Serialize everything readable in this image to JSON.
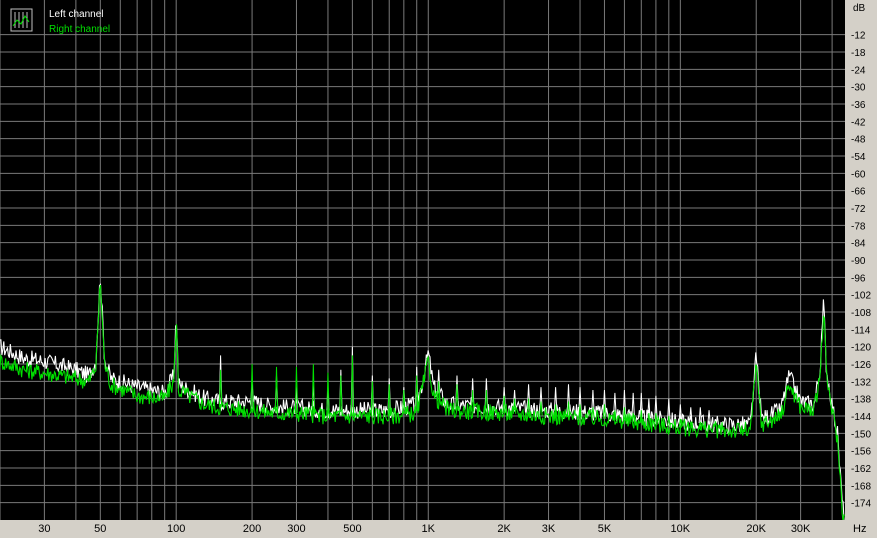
{
  "chart_data": {
    "type": "line",
    "x_scale": "log",
    "xlim": [
      20,
      45000
    ],
    "ylim": [
      -180,
      0
    ],
    "grid": true,
    "legend_position": "top-left",
    "xlabel_unit": "Hz",
    "ylabel_unit": "dB",
    "x_ticks": [
      {
        "value": 30,
        "label": "30"
      },
      {
        "value": 50,
        "label": "50"
      },
      {
        "value": 100,
        "label": "100"
      },
      {
        "value": 200,
        "label": "200"
      },
      {
        "value": 300,
        "label": "300"
      },
      {
        "value": 500,
        "label": "500"
      },
      {
        "value": 1000,
        "label": "1K"
      },
      {
        "value": 2000,
        "label": "2K"
      },
      {
        "value": 3000,
        "label": "3K"
      },
      {
        "value": 5000,
        "label": "5K"
      },
      {
        "value": 10000,
        "label": "10K"
      },
      {
        "value": 20000,
        "label": "20K"
      },
      {
        "value": 30000,
        "label": "30K"
      }
    ],
    "y_ticks": [
      -12,
      -18,
      -24,
      -30,
      -36,
      -42,
      -48,
      -54,
      -60,
      -66,
      -72,
      -78,
      -84,
      -90,
      -96,
      -102,
      -108,
      -114,
      -120,
      -126,
      -132,
      -138,
      -144,
      -150,
      -156,
      -162,
      -168,
      -174
    ],
    "series": [
      {
        "name": "Left channel",
        "color": "#ffffff",
        "points": [
          [
            20,
            -120
          ],
          [
            25,
            -124
          ],
          [
            30,
            -125
          ],
          [
            40,
            -128
          ],
          [
            45,
            -130
          ],
          [
            48,
            -125
          ],
          [
            50,
            -95
          ],
          [
            52,
            -124
          ],
          [
            55,
            -131
          ],
          [
            70,
            -134
          ],
          [
            90,
            -136
          ],
          [
            98,
            -130
          ],
          [
            100,
            -107
          ],
          [
            102,
            -133
          ],
          [
            130,
            -138
          ],
          [
            150,
            -139
          ],
          [
            200,
            -139
          ],
          [
            250,
            -141
          ],
          [
            300,
            -141
          ],
          [
            400,
            -142
          ],
          [
            500,
            -142
          ],
          [
            700,
            -142
          ],
          [
            900,
            -140
          ],
          [
            950,
            -132
          ],
          [
            1000,
            -122
          ],
          [
            1050,
            -134
          ],
          [
            1200,
            -140
          ],
          [
            2000,
            -141
          ],
          [
            3000,
            -142
          ],
          [
            5000,
            -143
          ],
          [
            8000,
            -145
          ],
          [
            10000,
            -146
          ],
          [
            15000,
            -147
          ],
          [
            19000,
            -147
          ],
          [
            20000,
            -123
          ],
          [
            21000,
            -145
          ],
          [
            25000,
            -142
          ],
          [
            27000,
            -130
          ],
          [
            30000,
            -139
          ],
          [
            34000,
            -140
          ],
          [
            36000,
            -126
          ],
          [
            37000,
            -104
          ],
          [
            38000,
            -128
          ],
          [
            40000,
            -140
          ],
          [
            42000,
            -150
          ],
          [
            44000,
            -175
          ],
          [
            45000,
            -180
          ]
        ],
        "peaks": [
          [
            150,
            -123
          ],
          [
            200,
            -132
          ],
          [
            250,
            -130
          ],
          [
            300,
            -134
          ],
          [
            350,
            -133
          ],
          [
            400,
            -134
          ],
          [
            450,
            -128
          ],
          [
            500,
            -120
          ],
          [
            600,
            -130
          ],
          [
            700,
            -131
          ],
          [
            800,
            -134
          ],
          [
            900,
            -127
          ],
          [
            1100,
            -128
          ],
          [
            1300,
            -130
          ],
          [
            1500,
            -131
          ],
          [
            1700,
            -131
          ],
          [
            2000,
            -134
          ],
          [
            2200,
            -135
          ],
          [
            2500,
            -133
          ],
          [
            2800,
            -134
          ],
          [
            3200,
            -134
          ],
          [
            3600,
            -133
          ],
          [
            4000,
            -134
          ],
          [
            4500,
            -135
          ],
          [
            5000,
            -135
          ],
          [
            5500,
            -136
          ],
          [
            6000,
            -135
          ],
          [
            6500,
            -136
          ],
          [
            7000,
            -136
          ],
          [
            7500,
            -138
          ],
          [
            8000,
            -137
          ],
          [
            9000,
            -138
          ],
          [
            10000,
            -140
          ],
          [
            11000,
            -141
          ],
          [
            12000,
            -141
          ],
          [
            13000,
            -142
          ]
        ]
      },
      {
        "name": "Right channel",
        "color": "#00e000",
        "points": [
          [
            20,
            -125
          ],
          [
            25,
            -128
          ],
          [
            30,
            -129
          ],
          [
            40,
            -131
          ],
          [
            45,
            -132
          ],
          [
            48,
            -127
          ],
          [
            50,
            -97
          ],
          [
            52,
            -126
          ],
          [
            55,
            -133
          ],
          [
            70,
            -137
          ],
          [
            90,
            -138
          ],
          [
            98,
            -132
          ],
          [
            100,
            -109
          ],
          [
            102,
            -135
          ],
          [
            130,
            -140
          ],
          [
            150,
            -141
          ],
          [
            200,
            -142
          ],
          [
            250,
            -143
          ],
          [
            300,
            -143
          ],
          [
            400,
            -144
          ],
          [
            500,
            -144
          ],
          [
            700,
            -144
          ],
          [
            900,
            -143
          ],
          [
            950,
            -134
          ],
          [
            1000,
            -125
          ],
          [
            1050,
            -137
          ],
          [
            1200,
            -142
          ],
          [
            2000,
            -143
          ],
          [
            3000,
            -144
          ],
          [
            5000,
            -145
          ],
          [
            8000,
            -147
          ],
          [
            10000,
            -148
          ],
          [
            15000,
            -149
          ],
          [
            19000,
            -149
          ],
          [
            20000,
            -126
          ],
          [
            21000,
            -147
          ],
          [
            25000,
            -144
          ],
          [
            27000,
            -133
          ],
          [
            30000,
            -141
          ],
          [
            34000,
            -142
          ],
          [
            36000,
            -128
          ],
          [
            37000,
            -107
          ],
          [
            38000,
            -130
          ],
          [
            40000,
            -142
          ],
          [
            42000,
            -152
          ],
          [
            44000,
            -177
          ],
          [
            45000,
            -180
          ]
        ],
        "peaks": [
          [
            150,
            -128
          ],
          [
            200,
            -126
          ],
          [
            250,
            -127
          ],
          [
            300,
            -127
          ],
          [
            350,
            -126
          ],
          [
            400,
            -129
          ],
          [
            450,
            -130
          ],
          [
            500,
            -123
          ],
          [
            600,
            -132
          ],
          [
            700,
            -133
          ],
          [
            800,
            -135
          ],
          [
            900,
            -130
          ],
          [
            1100,
            -132
          ],
          [
            1300,
            -133
          ],
          [
            1500,
            -135
          ],
          [
            1700,
            -135
          ],
          [
            2000,
            -137
          ],
          [
            2200,
            -138
          ],
          [
            2500,
            -138
          ],
          [
            2800,
            -139
          ],
          [
            3200,
            -140
          ],
          [
            3600,
            -139
          ],
          [
            4000,
            -140
          ],
          [
            4500,
            -141
          ],
          [
            5000,
            -140
          ],
          [
            5500,
            -142
          ],
          [
            6000,
            -141
          ],
          [
            6500,
            -143
          ],
          [
            7000,
            -142
          ],
          [
            7500,
            -143
          ],
          [
            8000,
            -143
          ],
          [
            9000,
            -144
          ],
          [
            10000,
            -145
          ],
          [
            11000,
            -146
          ],
          [
            12000,
            -146
          ],
          [
            13000,
            -147
          ]
        ]
      }
    ]
  }
}
